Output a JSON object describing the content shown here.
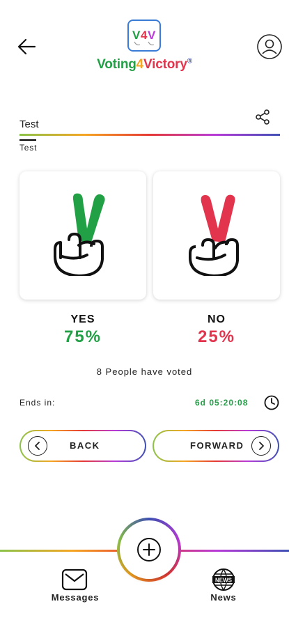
{
  "header": {
    "brand": {
      "part1": "Voting",
      "part2": "4",
      "part3": "Victory",
      "reg": "®"
    },
    "logo_mark": "V4V"
  },
  "poll": {
    "title": "Test",
    "description": "Test",
    "yes": {
      "label": "YES",
      "percent": "75%"
    },
    "no": {
      "label": "NO",
      "percent": "25%"
    },
    "voted_text": "8 People have voted",
    "ends_label": "Ends in:",
    "timer": "6d 05:20:08"
  },
  "buttons": {
    "back": "BACK",
    "forward": "FORWARD"
  },
  "bottom_nav": {
    "messages": "Messages",
    "news": "News"
  },
  "icons": {
    "back": "arrow-left-icon",
    "profile": "user-circle-icon",
    "share": "share-icon",
    "clock": "clock-icon",
    "add": "plus-circle-icon",
    "messages": "envelope-icon",
    "news": "globe-news-icon"
  },
  "colors": {
    "yes_green": "#22a046",
    "no_red": "#e2354d",
    "rainbow": [
      "#8bc34a",
      "#f5a623",
      "#e53935",
      "#b83bd8",
      "#3f51b5"
    ]
  }
}
